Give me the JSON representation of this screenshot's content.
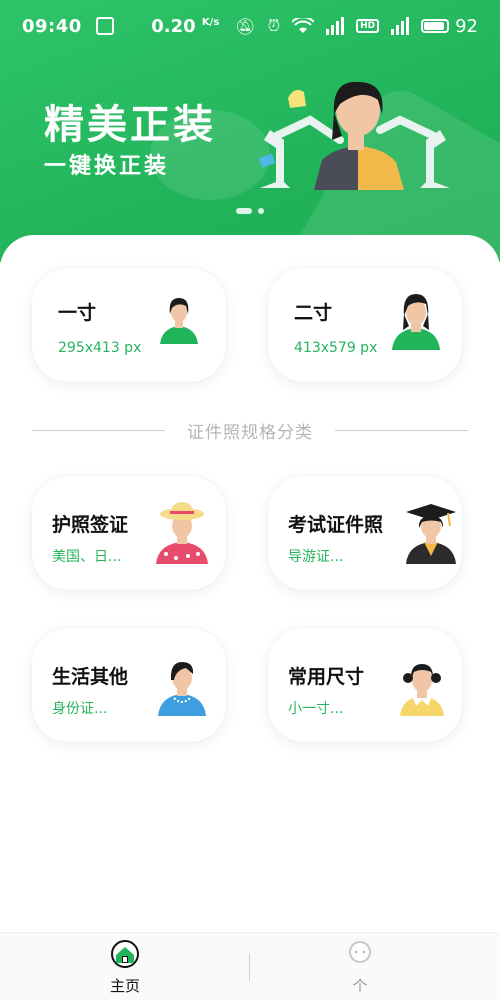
{
  "status_bar": {
    "time": "09:40",
    "speed": "0.20",
    "speed_unit": "K/s",
    "battery": "92"
  },
  "banner": {
    "title": "精美正装",
    "subtitle": "一键换正装"
  },
  "size_cards": [
    {
      "title": "一寸",
      "sub": "295x413 px"
    },
    {
      "title": "二寸",
      "sub": "413x579 px"
    }
  ],
  "section_label": "证件照规格分类",
  "category_cards": [
    {
      "title": "护照签证",
      "sub": "美国、日..."
    },
    {
      "title": "考试证件照",
      "sub": "导游证..."
    },
    {
      "title": "生活其他",
      "sub": "身份证..."
    },
    {
      "title": "常用尺寸",
      "sub": "小一寸..."
    }
  ],
  "bottom_nav": {
    "home_label": "主页",
    "mine_label": "个"
  },
  "colors": {
    "brand": "#22b45a",
    "accent_text": "#27b35c"
  }
}
